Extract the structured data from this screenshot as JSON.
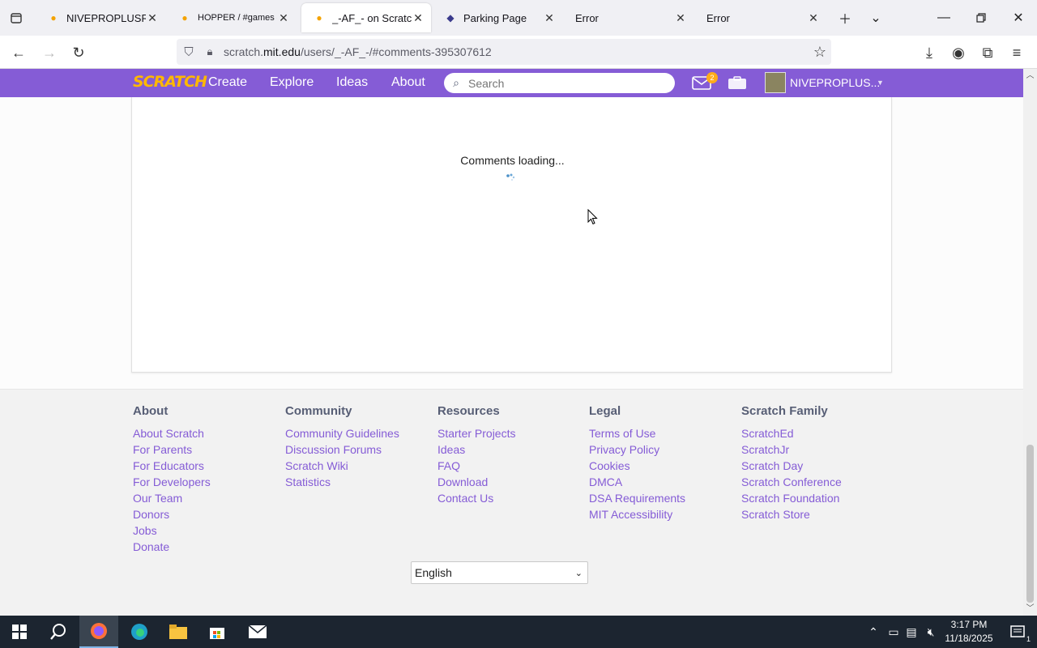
{
  "browser": {
    "tabs": [
      {
        "title": "NIVEPROPLUSRETURNS",
        "active": false
      },
      {
        "title": "HOPPER / #games #trending",
        "active": false
      },
      {
        "title": "_-AF_- on Scratch",
        "active": true
      },
      {
        "title": "Parking Page",
        "active": false
      },
      {
        "title": "Error",
        "active": false
      },
      {
        "title": "Error",
        "active": false
      }
    ],
    "url_prefix": "scratch.",
    "url_host": "mit.edu",
    "url_path": "/users/_-AF_-/#comments-395307612"
  },
  "scratch_header": {
    "logo": "SCRATCH",
    "nav": [
      "Create",
      "Explore",
      "Ideas",
      "About"
    ],
    "search_placeholder": "Search",
    "message_count": "2",
    "username": "NIVEPROPLUS..."
  },
  "comments": {
    "loading_text": "Comments loading..."
  },
  "footer": {
    "columns": [
      {
        "title": "About",
        "links": [
          "About Scratch",
          "For Parents",
          "For Educators",
          "For Developers",
          "Our Team",
          "Donors",
          "Jobs",
          "Donate"
        ]
      },
      {
        "title": "Community",
        "links": [
          "Community Guidelines",
          "Discussion Forums",
          "Scratch Wiki",
          "Statistics"
        ]
      },
      {
        "title": "Resources",
        "links": [
          "Starter Projects",
          "Ideas",
          "FAQ",
          "Download",
          "Contact Us"
        ]
      },
      {
        "title": "Legal",
        "links": [
          "Terms of Use",
          "Privacy Policy",
          "Cookies",
          "DMCA",
          "DSA Requirements",
          "MIT Accessibility"
        ]
      },
      {
        "title": "Scratch Family",
        "links": [
          "ScratchEd",
          "ScratchJr",
          "Scratch Day",
          "Scratch Conference",
          "Scratch Foundation",
          "Scratch Store"
        ]
      }
    ],
    "language": "English"
  },
  "taskbar": {
    "time": "3:17 PM",
    "date": "11/18/2025",
    "notification_count": "1"
  },
  "colors": {
    "scratch_purple": "#855cd6",
    "link_purple": "#855cd6",
    "taskbar_bg": "#1c2530"
  }
}
